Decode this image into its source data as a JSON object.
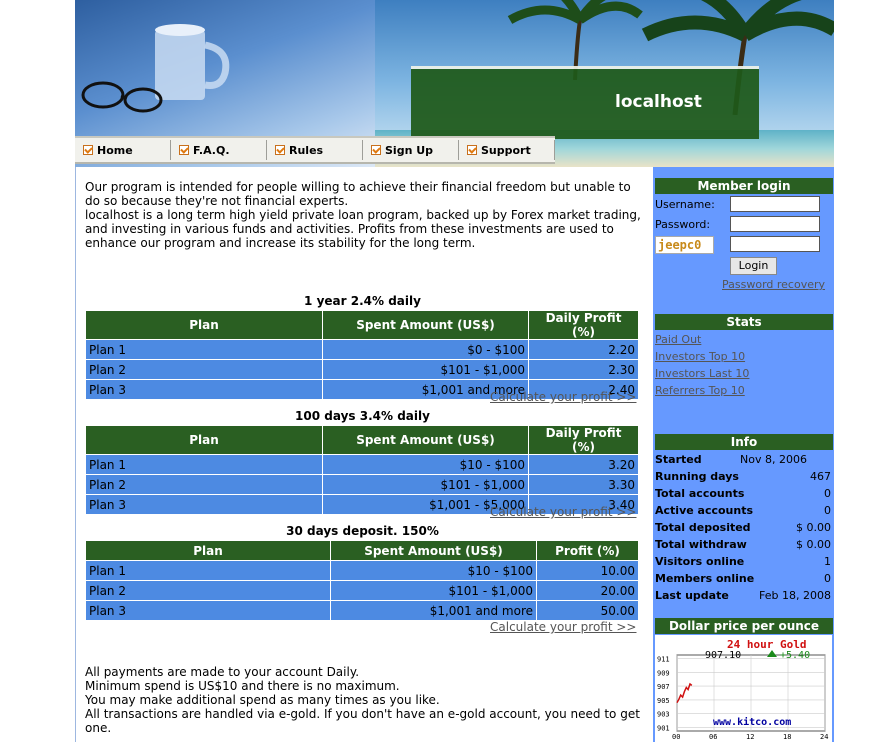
{
  "site": {
    "name": "localhost"
  },
  "nav": [
    {
      "label": "Home"
    },
    {
      "label": "F.A.Q."
    },
    {
      "label": "Rules"
    },
    {
      "label": "Sign Up"
    },
    {
      "label": "Support"
    }
  ],
  "intro": {
    "p1": "Our program is intended for people willing to achieve their financial freedom but unable to do so because they're not financial experts.",
    "p2": "localhost is a long term high yield private loan program, backed up by Forex market trading, and investing in various funds and activities. Profits from these investments are used to enhance our program and increase its stability for the long term."
  },
  "plans": [
    {
      "title": "1 year 2.4% daily",
      "headers": [
        "Plan",
        "Spent Amount (US$)",
        "Daily Profit (%)"
      ],
      "rows": [
        [
          "Plan 1",
          "$0 - $100",
          "2.20"
        ],
        [
          "Plan 2",
          "$101 - $1,000",
          "2.30"
        ],
        [
          "Plan 3",
          "$1,001 and more",
          "2.40"
        ]
      ],
      "calc": "Calculate your profit >>"
    },
    {
      "title": "100 days 3.4% daily",
      "headers": [
        "Plan",
        "Spent Amount (US$)",
        "Daily Profit (%)"
      ],
      "rows": [
        [
          "Plan 1",
          "$10 - $100",
          "3.20"
        ],
        [
          "Plan 2",
          "$101 - $1,000",
          "3.30"
        ],
        [
          "Plan 3",
          "$1,001 - $5,000",
          "3.40"
        ]
      ],
      "calc": "Calculate your profit >>"
    },
    {
      "title": "30 days deposit. 150%",
      "headers": [
        "Plan",
        "Spent Amount (US$)",
        "Profit (%)"
      ],
      "rows": [
        [
          "Plan 1",
          "$10 - $100",
          "10.00"
        ],
        [
          "Plan 2",
          "$101 - $1,000",
          "20.00"
        ],
        [
          "Plan 3",
          "$1,001 and more",
          "50.00"
        ]
      ],
      "calc": "Calculate your profit >>"
    }
  ],
  "footer": {
    "l1": "All payments are made to your account Daily.",
    "l2": "Minimum spend is US$10 and there is no maximum.",
    "l3": "You may make additional spend as many times as you like.",
    "l4": "All transactions are handled via e-gold. If you don't have an e-gold account, you need to get one."
  },
  "login": {
    "title": "Member login",
    "username_label": "Username:",
    "password_label": "Password:",
    "captcha": "jeepc0",
    "button": "Login",
    "recovery": "Password recovery"
  },
  "stats": {
    "title": "Stats",
    "links": [
      "Paid Out",
      "Investors Top 10",
      "Investors Last 10",
      "Referrers Top 10"
    ]
  },
  "info": {
    "title": "Info",
    "rows": [
      {
        "k": "Started",
        "v": "Nov 8, 2006"
      },
      {
        "k": "Running days",
        "v": "467"
      },
      {
        "k": "Total accounts",
        "v": "0"
      },
      {
        "k": "Active accounts",
        "v": "0"
      },
      {
        "k": "Total deposited",
        "v": "$ 0.00"
      },
      {
        "k": "Total withdraw",
        "v": "$ 0.00"
      },
      {
        "k": "Visitors online",
        "v": "1"
      },
      {
        "k": "Members online",
        "v": "0"
      },
      {
        "k": "Last update",
        "v": "Feb 18, 2008"
      }
    ]
  },
  "gold": {
    "title": "Dollar price per ounce",
    "chart_title": "24 hour Gold",
    "price": "907.10",
    "change": "+5.40",
    "watermark": "www.kitco.com",
    "yticks": [
      "911",
      "909",
      "907",
      "905",
      "903",
      "901"
    ],
    "xticks": [
      "00",
      "06",
      "12",
      "18",
      "24"
    ],
    "colors": {
      "title": "#d01010",
      "change": "#1a8a1a",
      "watermark": "#0000a0",
      "line": "#d01010"
    }
  },
  "chart_data": {
    "type": "line",
    "title": "24 hour Gold",
    "x": [
      0.0,
      0.3,
      0.6,
      0.9,
      1.2,
      1.5,
      1.8,
      2.1,
      2.4
    ],
    "y": [
      904.6,
      905.1,
      905.7,
      905.4,
      906.2,
      906.8,
      906.5,
      907.3,
      907.1
    ],
    "xlim": [
      0,
      24
    ],
    "ylim": [
      900.5,
      911.5
    ],
    "xlabel": "",
    "ylabel": "",
    "xticks": [
      "00",
      "06",
      "12",
      "18",
      "24"
    ],
    "yticks": [
      "911",
      "909",
      "907",
      "905",
      "903",
      "901"
    ]
  }
}
